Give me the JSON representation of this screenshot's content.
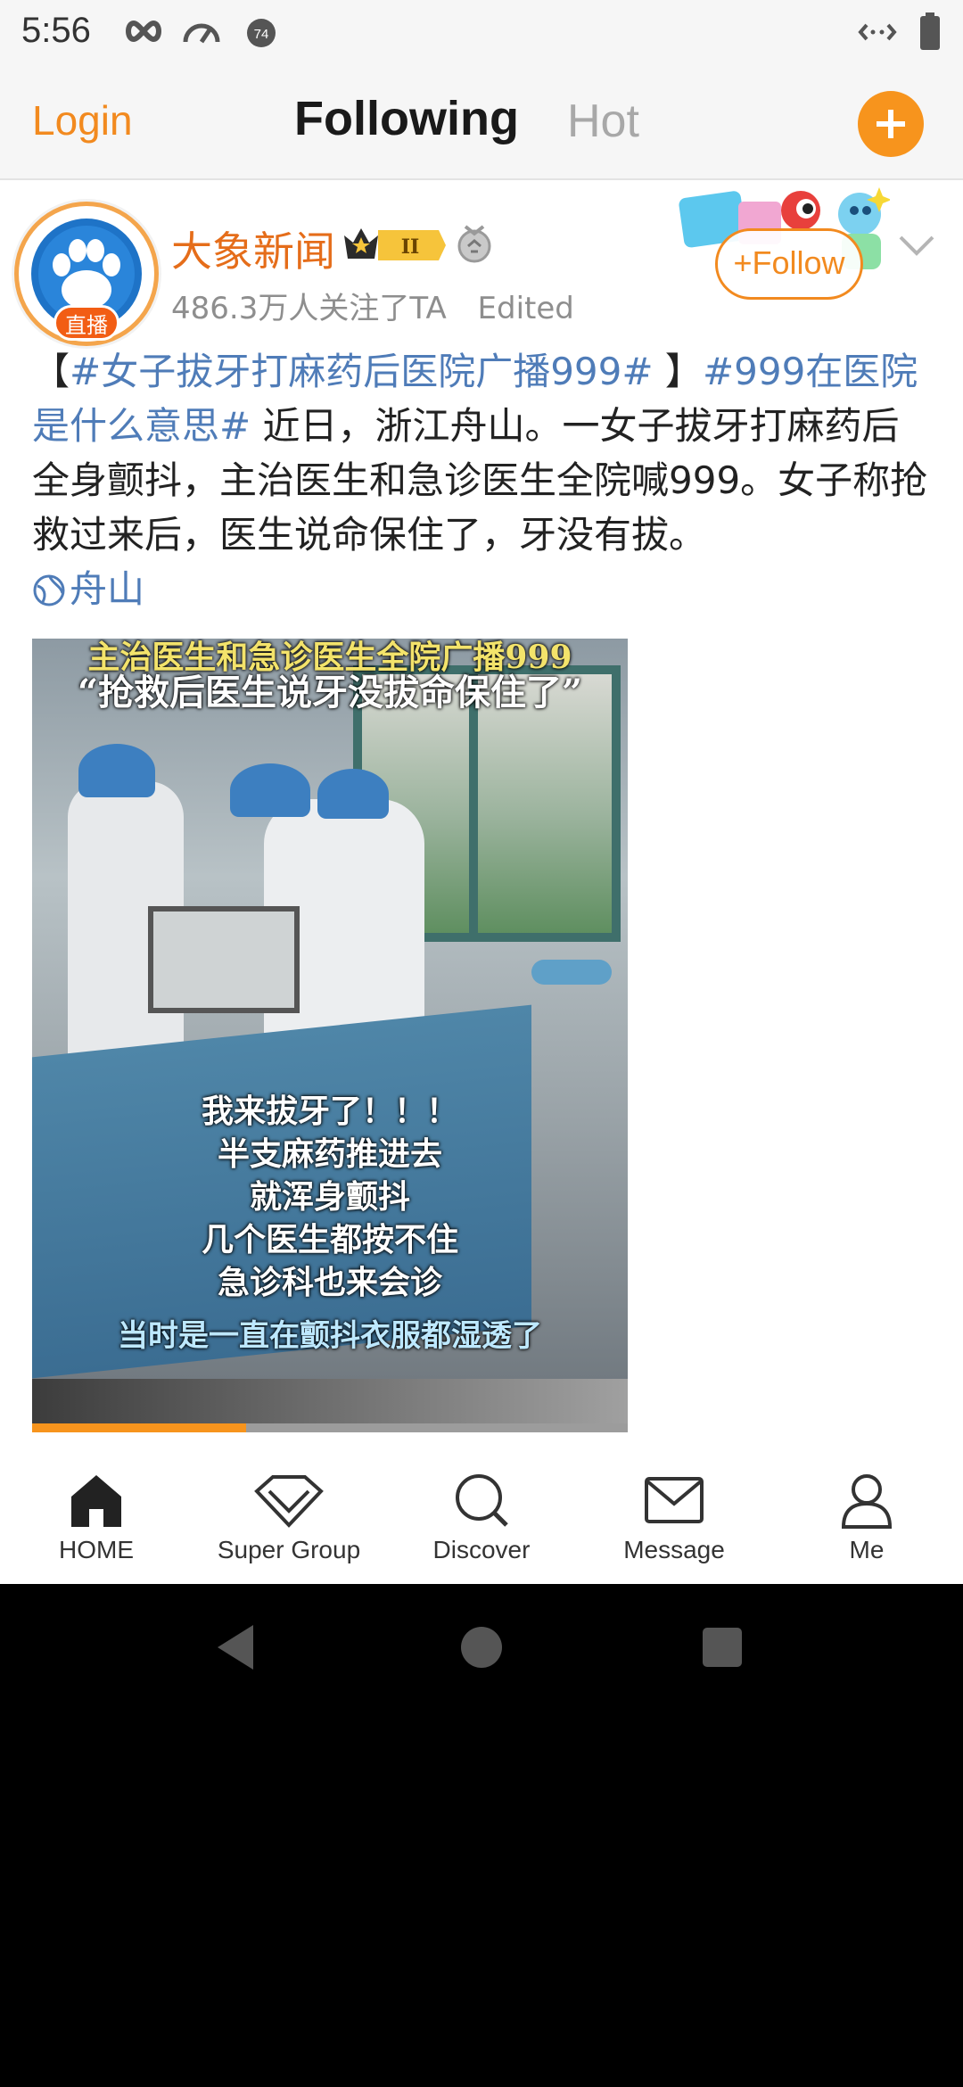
{
  "status_bar": {
    "time": "5:56",
    "icons": [
      "infinity-icon",
      "speedometer-icon",
      "notification-badge-icon",
      "data-transfer-icon",
      "battery-icon"
    ],
    "notification_badge": "74"
  },
  "top_nav": {
    "login_label": "Login",
    "tabs": [
      {
        "label": "Following",
        "active": true
      },
      {
        "label": "Hot",
        "active": false
      }
    ],
    "compose_icon": "plus-icon",
    "accent_color": "#f7941d"
  },
  "post": {
    "account_name": "大象新闻",
    "live_badge": "直播",
    "vip_level": "II",
    "follower_text": "486.3万人关注了TA",
    "edited_label": "Edited",
    "follow_label": "Follow",
    "text_prefix": "【",
    "hashtag_1": "#女子拔牙打麻药后医院广播999#",
    "text_mid": " 】",
    "hashtag_2": "#999在医院是什么意思#",
    "body": " 近日，浙江舟山。一女子拔牙打麻药后全身颤抖，主治医生和急诊医生全院喊999。女子称抢救过来后，医生说命保住了，牙没有拔。",
    "location": "舟山",
    "image": {
      "top_caption_1": "主治医生和急诊医生全院广播999",
      "top_caption_2": "“抢救后医生说牙没拔命保住了”",
      "center_caption": [
        "我来拔牙了！！！",
        "半支麻药推进去",
        "就浑身颤抖",
        "几个医生都按不住",
        "急诊科也来会诊"
      ],
      "bottom_caption": "当时是一直在颤抖衣服都湿透了",
      "progress": 0.36
    }
  },
  "bottom_nav": {
    "items": [
      {
        "label": "HOME",
        "icon": "home-icon"
      },
      {
        "label": "Super Group",
        "icon": "diamond-icon"
      },
      {
        "label": "Discover",
        "icon": "search-icon"
      },
      {
        "label": "Message",
        "icon": "envelope-icon"
      },
      {
        "label": "Me",
        "icon": "person-icon"
      }
    ]
  },
  "system_nav": {
    "icons": [
      "back-triangle-icon",
      "home-circle-icon",
      "recents-square-icon"
    ]
  }
}
